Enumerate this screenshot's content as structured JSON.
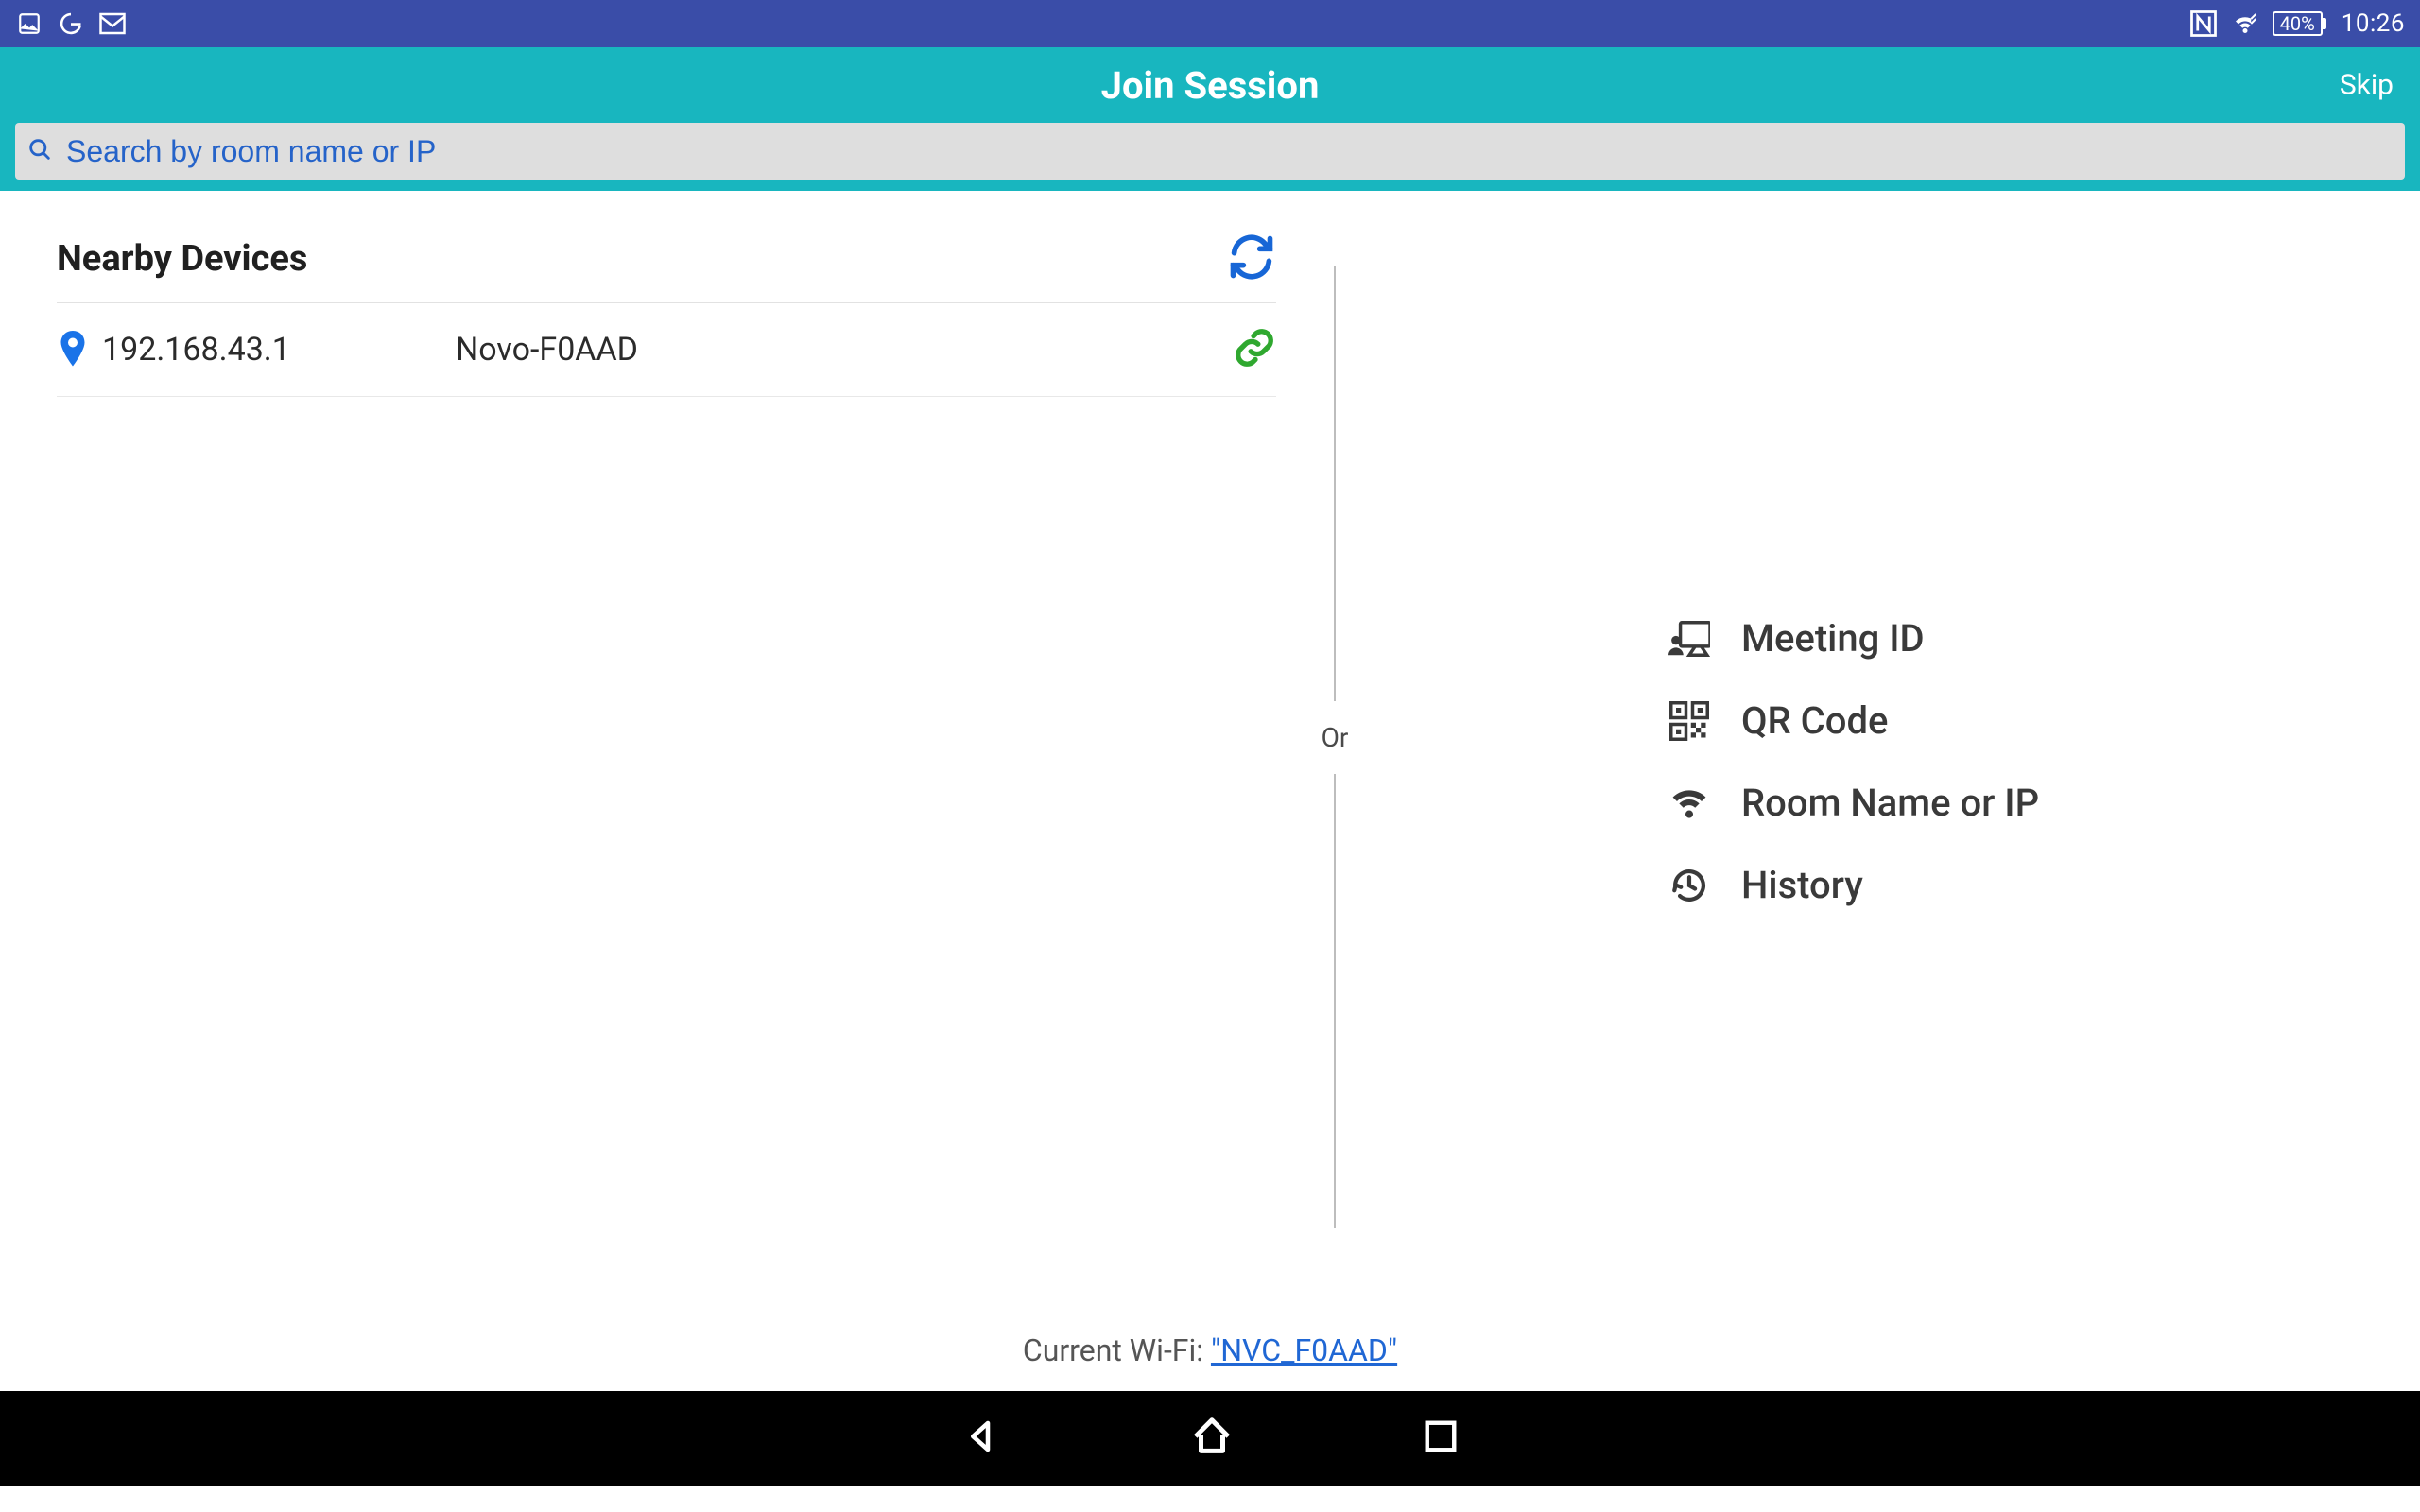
{
  "statusbar": {
    "battery_text": "40%",
    "clock": "10:26"
  },
  "header": {
    "title": "Join Session",
    "skip": "Skip"
  },
  "search": {
    "placeholder": "Search by room name or IP"
  },
  "nearby": {
    "title": "Nearby Devices",
    "device": {
      "ip": "192.168.43.1",
      "name": "Novo-F0AAD"
    }
  },
  "divider": {
    "or": "Or"
  },
  "options": {
    "meeting_id": "Meeting ID",
    "qr_code": "QR Code",
    "room_name_ip": "Room Name or IP",
    "history": "History"
  },
  "wifi": {
    "label": "Current Wi-Fi: ",
    "ssid": "\"NVC_F0AAD\""
  }
}
